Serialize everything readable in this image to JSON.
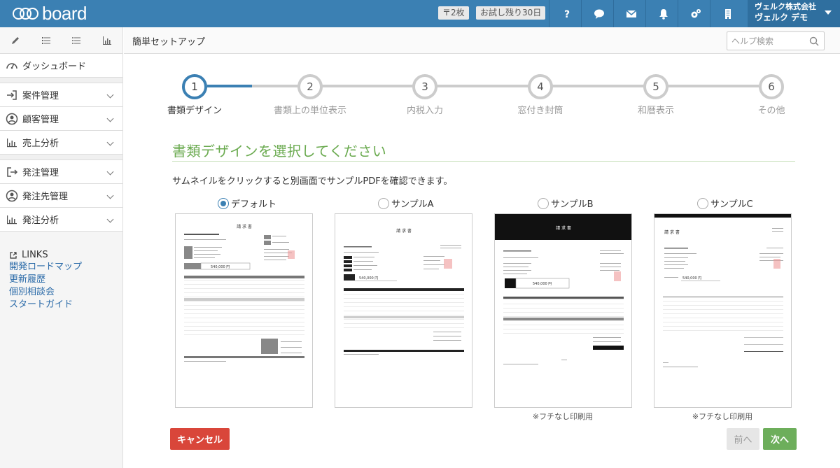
{
  "app": {
    "logo_text": "board"
  },
  "topbar": {
    "badges": [
      "〒2枚",
      "お試し残り30日"
    ],
    "icons": [
      "help-icon",
      "chat-icon",
      "mail-icon",
      "bell-icon",
      "settings-icon",
      "building-icon"
    ],
    "user_company": "ヴェルク株式会社",
    "user_name": "ヴェルク デモ"
  },
  "sidebar": {
    "tools": [
      "pencil-icon",
      "list-icon",
      "list-alt-icon",
      "chart-icon"
    ],
    "dashboard": "ダッシュボード",
    "group1": [
      "案件管理",
      "顧客管理",
      "売上分析"
    ],
    "group2": [
      "発注管理",
      "発注先管理",
      "発注分析"
    ],
    "links_title": "LINKS",
    "links": [
      "開発ロードマップ",
      "更新履歴",
      "個別相談会",
      "スタートガイド"
    ]
  },
  "header": {
    "title": "簡単セットアップ",
    "search_placeholder": "ヘルプ検索"
  },
  "steps": [
    {
      "num": "1",
      "label": "書類デザイン"
    },
    {
      "num": "2",
      "label": "書類上の単位表示"
    },
    {
      "num": "3",
      "label": "内税入力"
    },
    {
      "num": "4",
      "label": "窓付き封筒"
    },
    {
      "num": "5",
      "label": "和暦表示"
    },
    {
      "num": "6",
      "label": "その他"
    }
  ],
  "main": {
    "heading": "書類デザインを選択してください",
    "description": "サムネイルをクリックすると別画面でサンプルPDFを確認できます。",
    "options": [
      {
        "label": "デフォルト",
        "selected": true
      },
      {
        "label": "サンプルA",
        "selected": false
      },
      {
        "label": "サンプルB",
        "selected": false
      },
      {
        "label": "サンプルC",
        "selected": false
      }
    ],
    "doc_title": "請 求 書",
    "doc_amount": "540,000 円",
    "borderless_note": "※フチなし印刷用"
  },
  "buttons": {
    "cancel": "キャンセル",
    "prev": "前へ",
    "next": "次へ"
  },
  "colors": {
    "topbar": "#3b80b3",
    "accent_green": "#6aaa4f",
    "cancel": "#d9463a",
    "next": "#6dae5b"
  }
}
